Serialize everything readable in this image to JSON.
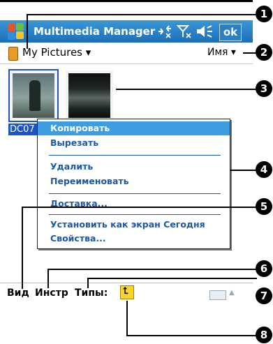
{
  "title_bar": {
    "app_title": "Multimedia Manager",
    "ok_label": "ok"
  },
  "header": {
    "folder_name": "My Pictures ▾",
    "sort_label": "Имя ▾"
  },
  "thumbnails": [
    {
      "label": "DC07"
    }
  ],
  "context_menu": {
    "items": [
      {
        "label": "Копировать",
        "selected": true
      },
      {
        "label": "Вырезать",
        "selected": false
      },
      {
        "label": "Удалить",
        "selected": false
      },
      {
        "label": "Переименовать",
        "selected": false
      },
      {
        "label": "Доставка...",
        "selected": false
      },
      {
        "label": "Установить как экран Сегодня",
        "selected": false
      },
      {
        "label": "Свойства...",
        "selected": false
      }
    ]
  },
  "menu_bar": {
    "view_label": "Вид",
    "tools_label": "Инстр",
    "types_label": "Типы:",
    "up_folder_glyph": "⮤"
  },
  "callouts": [
    "1",
    "2",
    "3",
    "4",
    "5",
    "6",
    "7",
    "8"
  ],
  "colors": {
    "title_bar": "#1d6fb8",
    "menu_text": "#1c58a8",
    "menu_selected": "#3d9de0",
    "selection": "#1c54c4"
  }
}
